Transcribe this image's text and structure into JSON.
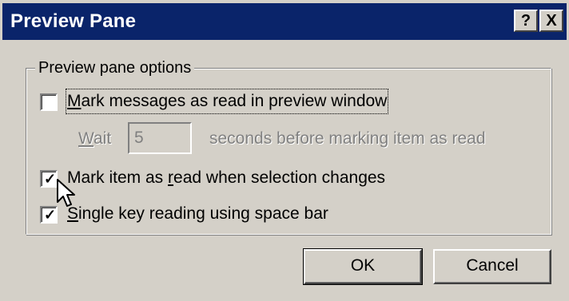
{
  "window": {
    "title": "Preview Pane",
    "help_glyph": "?",
    "close_glyph": "X"
  },
  "group": {
    "legend": "Preview pane options"
  },
  "options": {
    "mark_preview": {
      "label": "Mark messages as read in preview window",
      "checked": false
    },
    "wait": {
      "label": "Wait",
      "value": "5",
      "suffix": "seconds before marking item as read",
      "enabled": false
    },
    "mark_selection": {
      "label": "Mark item as read when selection changes",
      "checked": true
    },
    "single_key": {
      "label": "Single key reading using space bar",
      "checked": true
    }
  },
  "buttons": {
    "ok": "OK",
    "cancel": "Cancel"
  },
  "colors": {
    "titlebar": "#0a246a",
    "face": "#d4d0c8",
    "disabled_text": "#808080"
  },
  "icons": {
    "cursor": "arrow-pointer-icon",
    "check": "check-mark-icon"
  }
}
